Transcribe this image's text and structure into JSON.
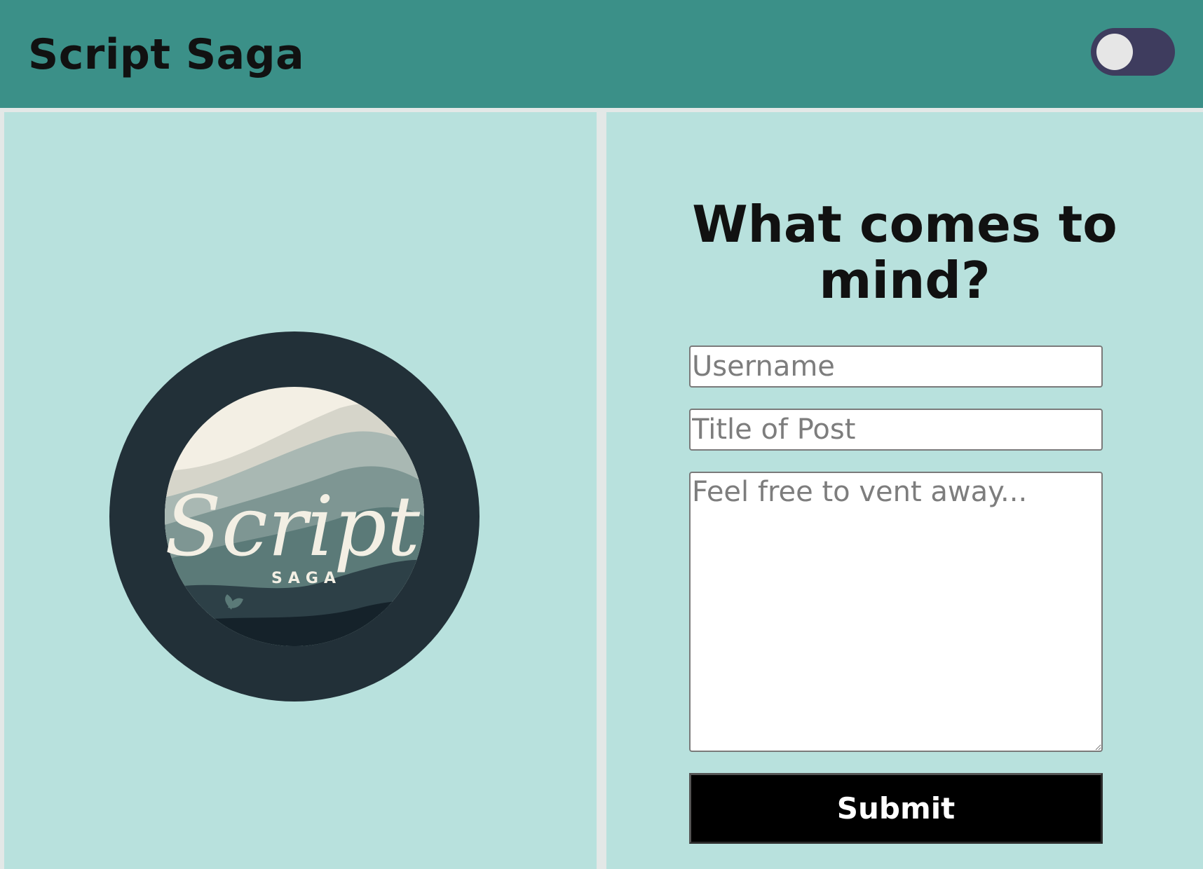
{
  "header": {
    "brand": "Script Saga",
    "theme_toggle": {
      "state": "off"
    }
  },
  "logo": {
    "script_text": "Script",
    "saga_text": "SAGA",
    "colors": {
      "ring": "#223038",
      "cream": "#f3efe4",
      "mist": "#a9b8b3",
      "sea": "#5b7a78",
      "deep": "#15222a"
    }
  },
  "form": {
    "heading": "What comes to mind?",
    "username_placeholder": "Username",
    "title_placeholder": "Title of Post",
    "body_placeholder": "Feel free to vent away...",
    "submit_label": "Submit"
  },
  "colors": {
    "header_bg": "#3b9088",
    "panel_bg": "#b8e1dd",
    "toggle_bg": "#3e3c5e",
    "button_bg": "#000000"
  }
}
